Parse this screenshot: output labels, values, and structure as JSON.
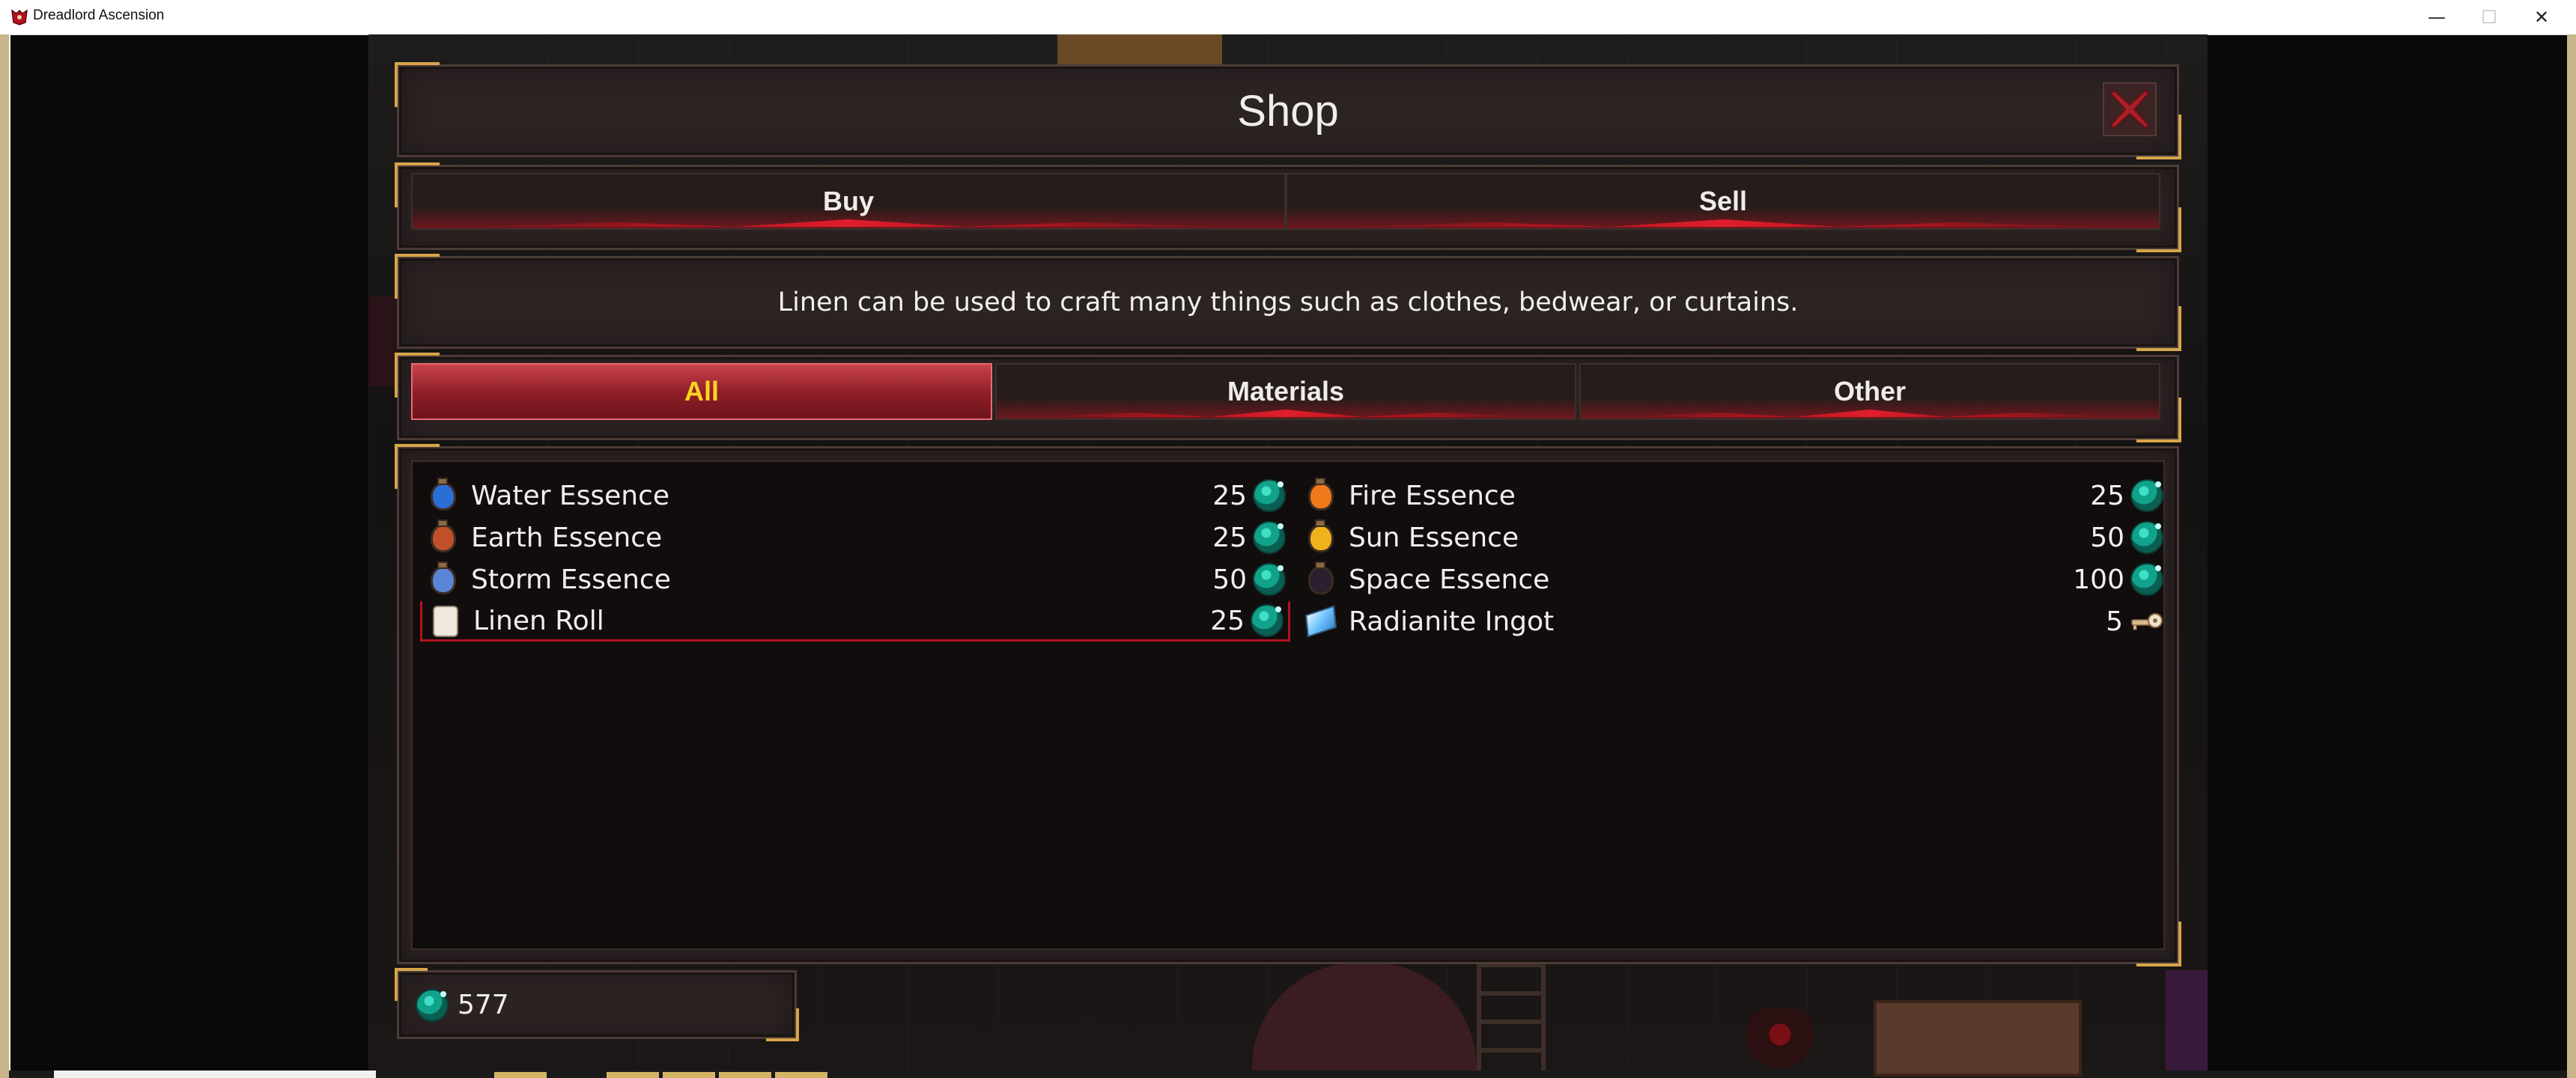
{
  "window": {
    "title": "Dreadlord Ascension",
    "minimize": "—",
    "maximize": "☐",
    "close": "✕"
  },
  "shop": {
    "title": "Shop",
    "close_icon": "close-x-icon",
    "modes": [
      {
        "label": "Buy",
        "active": false
      },
      {
        "label": "Sell",
        "active": false
      }
    ],
    "description": "Linen can be used to craft many things such as clothes, bedwear, or curtains.",
    "categories": [
      {
        "label": "All",
        "active": true
      },
      {
        "label": "Materials",
        "active": false
      },
      {
        "label": "Other",
        "active": false
      }
    ],
    "items": [
      {
        "name": "Water Essence",
        "price": "25",
        "currency": "gem",
        "icon": "water-essence-icon",
        "color": "#2a6fd6"
      },
      {
        "name": "Fire Essence",
        "price": "25",
        "currency": "gem",
        "icon": "fire-essence-icon",
        "color": "#f07a1a"
      },
      {
        "name": "Earth Essence",
        "price": "25",
        "currency": "gem",
        "icon": "earth-essence-icon",
        "color": "#c0502a"
      },
      {
        "name": "Sun Essence",
        "price": "50",
        "currency": "gem",
        "icon": "sun-essence-icon",
        "color": "#f0b21a"
      },
      {
        "name": "Storm Essence",
        "price": "50",
        "currency": "gem",
        "icon": "storm-essence-icon",
        "color": "#5a86d8"
      },
      {
        "name": "Space Essence",
        "price": "100",
        "currency": "gem",
        "icon": "space-essence-icon",
        "color": "#2a2030"
      },
      {
        "name": "Linen Roll",
        "price": "25",
        "currency": "gem",
        "icon": "linen-roll-icon",
        "selected": true
      },
      {
        "name": "Radianite Ingot",
        "price": "5",
        "currency": "key",
        "icon": "radianite-ingot-icon"
      }
    ],
    "balance": "577",
    "colors": {
      "accent_red": "#b5121f",
      "active_tab_text": "#ffd41f",
      "gem": "#11a38a",
      "gold_trim": "#d7a54a"
    }
  }
}
